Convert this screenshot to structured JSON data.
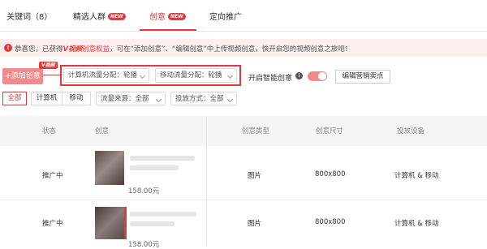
{
  "tabs": [
    {
      "label": "关键词（8）"
    },
    {
      "label": "精选人群",
      "badge": "NEW"
    },
    {
      "label": "创意",
      "badge": "NEW",
      "active": true
    },
    {
      "label": "定向推广"
    }
  ],
  "notice": {
    "prefix": "恭喜您，已获得",
    "highlight": "V视频",
    "highlight2": "创意权益",
    "suffix": "，可在“添加创意”、“编辑创意”中上传视频创意，快开启您的视频创意之旅吧！"
  },
  "toolbar": {
    "add_button": "+添加创意",
    "video_tag": "V视频",
    "pc_traffic_select": "计算机流量分配：轮播",
    "mobile_traffic_select": "移动流量分配：轮播",
    "smart_creative_label": "开启智能创意",
    "smart_creative_on": true,
    "edit_selling_points": "编辑营销卖点"
  },
  "filters": {
    "device_tabs": [
      "全部",
      "计算机",
      "移动"
    ],
    "traffic_source_select": "流量来源：全部",
    "delivery_method_select": "投放方式：全部"
  },
  "table": {
    "headers": [
      "状态",
      "创意",
      "创意类型",
      "创意尺寸",
      "投放设备"
    ],
    "rows": [
      {
        "status": "推广中",
        "price": "158.00元",
        "type": "图片",
        "size": "800x800",
        "device": "计算机 & 移动"
      },
      {
        "status": "推广中",
        "price": "158.00元",
        "type": "图片",
        "size": "800x800",
        "device": "计算机 & 移动"
      }
    ]
  },
  "colors": {
    "accent": "#e4393c",
    "accent_light": "#f08a8c",
    "notice_bg": "#fdeeee"
  },
  "icons": {
    "notice": "info-circle-icon",
    "smart_creative_help": "info-icon",
    "select_caret": "chevron-down-icon"
  }
}
